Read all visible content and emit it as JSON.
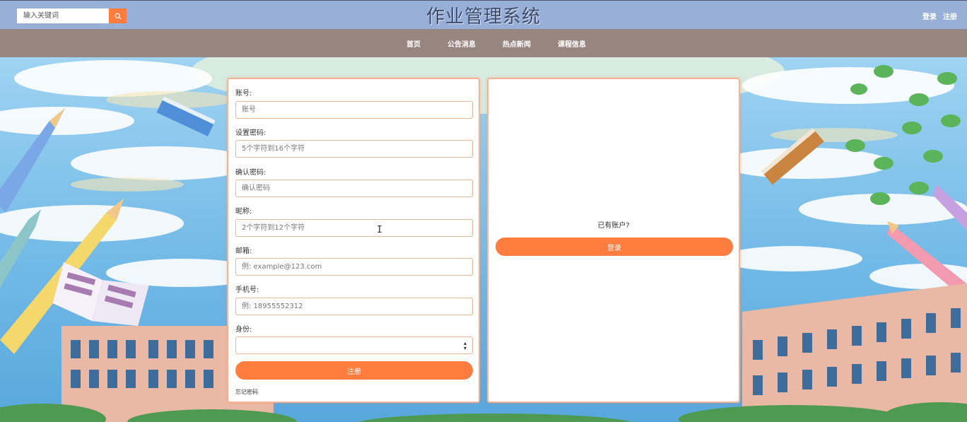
{
  "header": {
    "search_placeholder": "输入关键词",
    "title": "作业管理系统",
    "login_link": "登录",
    "register_link": "注册"
  },
  "nav": {
    "items": [
      "首页",
      "公告消息",
      "热点新闻",
      "课程信息"
    ]
  },
  "register_form": {
    "account_label": "账号:",
    "account_placeholder": "账号",
    "password_label": "设置密码:",
    "password_placeholder": "5个字符到16个字符",
    "confirm_label": "确认密码:",
    "confirm_placeholder": "确认密码",
    "nickname_label": "昵称:",
    "nickname_placeholder": "2个字符到12个字符",
    "email_label": "邮箱:",
    "email_placeholder": "例: example@123.com",
    "phone_label": "手机号:",
    "phone_placeholder": "例: 18955552312",
    "role_label": "身份:",
    "role_value": "",
    "submit_label": "注册",
    "forgot_label": "忘记密码"
  },
  "login_panel": {
    "has_account_text": "已有账户?",
    "login_button": "登录"
  },
  "colors": {
    "header_bg": "#98afd8",
    "nav_bg": "#978580",
    "accent": "#fe7c3d",
    "title": "#384a6e"
  }
}
